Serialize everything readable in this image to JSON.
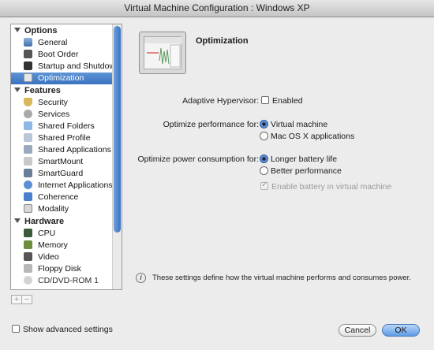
{
  "window": {
    "title": "Virtual Machine Configuration : Windows XP"
  },
  "sidebar": {
    "sections": [
      {
        "title": "Options",
        "items": [
          "General",
          "Boot Order",
          "Startup and Shutdown",
          "Optimization"
        ]
      },
      {
        "title": "Features",
        "items": [
          "Security",
          "Services",
          "Shared Folders",
          "Shared Profile",
          "Shared Applications",
          "SmartMount",
          "SmartGuard",
          "Internet Applications",
          "Coherence",
          "Modality"
        ]
      },
      {
        "title": "Hardware",
        "items": [
          "CPU",
          "Memory",
          "Video",
          "Floppy Disk",
          "CD/DVD-ROM 1"
        ]
      }
    ],
    "selected": "Optimization",
    "add_label": "+",
    "remove_label": "−"
  },
  "main": {
    "title": "Optimization",
    "adaptive": {
      "label": "Adaptive Hypervisor:",
      "option": "Enabled",
      "checked": false
    },
    "performance": {
      "label": "Optimize performance for:",
      "options": [
        "Virtual machine",
        "Mac OS X applications"
      ],
      "selected": "Virtual machine"
    },
    "power": {
      "label": "Optimize power consumption for:",
      "options": [
        "Longer battery life",
        "Better performance"
      ],
      "selected": "Longer battery life"
    },
    "battery": {
      "label": "Enable battery in virtual machine",
      "checked": true,
      "disabled": true
    },
    "info": "These settings define how the virtual machine performs and consumes power."
  },
  "footer": {
    "advanced_label": "Show advanced settings",
    "cancel_label": "Cancel",
    "ok_label": "OK"
  }
}
